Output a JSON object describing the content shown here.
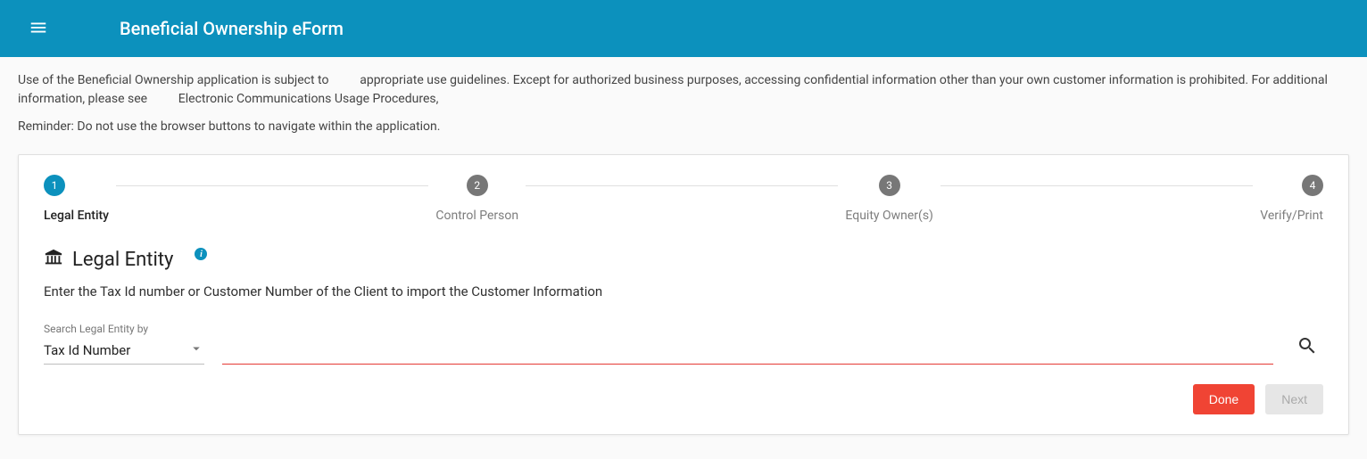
{
  "header": {
    "title": "Beneficial Ownership eForm"
  },
  "intro": {
    "line1a": "Use of the Beneficial Ownership application is subject to ",
    "line1b": " appropriate use guidelines. Except for authorized business purposes, accessing confidential information other than your own customer information is prohibited. For additional information, please see ",
    "line1c": " Electronic Communications Usage Procedures,",
    "line2": "Reminder: Do not use the browser buttons to navigate within the application."
  },
  "stepper": {
    "steps": [
      {
        "num": "1",
        "label": "Legal Entity",
        "active": true
      },
      {
        "num": "2",
        "label": "Control Person",
        "active": false
      },
      {
        "num": "3",
        "label": "Equity Owner(s)",
        "active": false
      },
      {
        "num": "4",
        "label": "Verify/Print",
        "active": false
      }
    ]
  },
  "section": {
    "title": "Legal Entity",
    "instruction": "Enter the Tax Id number or Customer Number of the Client to import the Customer Information"
  },
  "search": {
    "field_label": "Search Legal Entity by",
    "selected_option": "Tax Id Number",
    "input_value": ""
  },
  "actions": {
    "done": "Done",
    "next": "Next"
  }
}
